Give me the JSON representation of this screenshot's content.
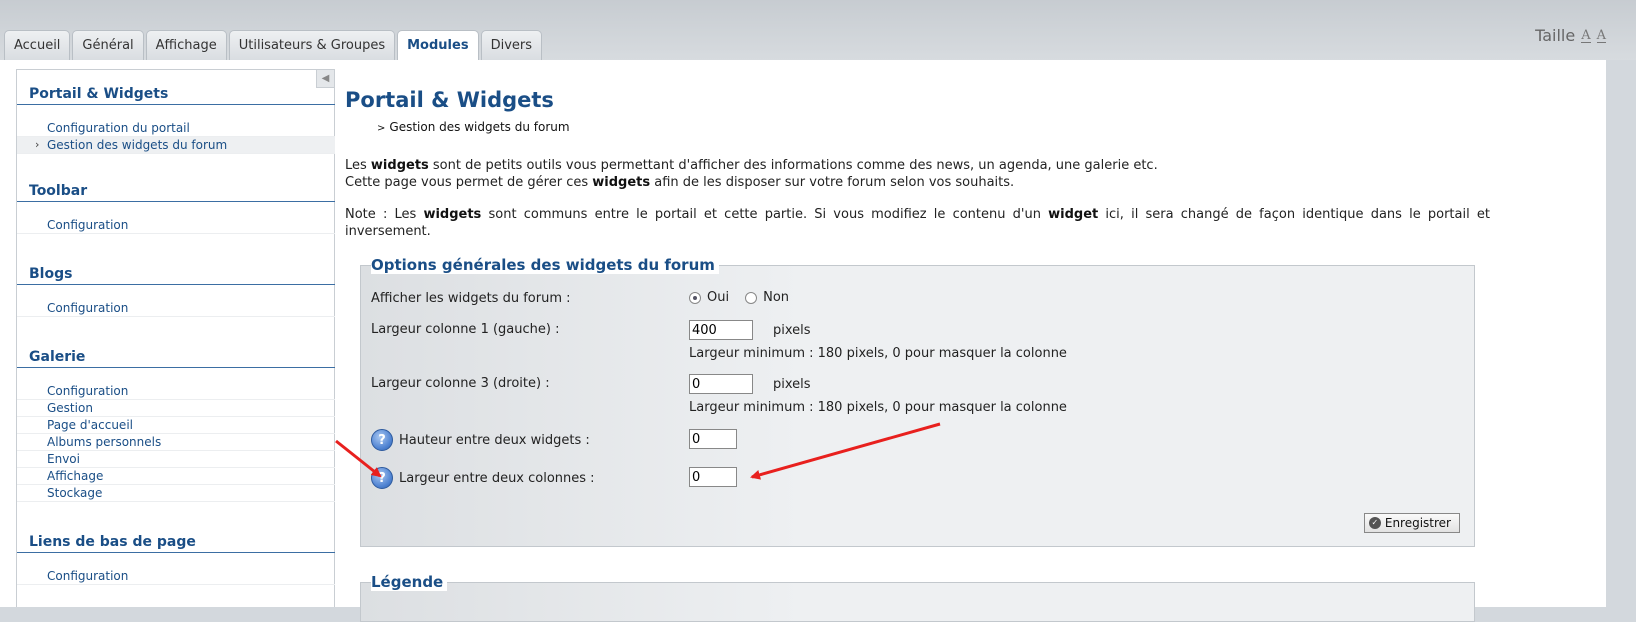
{
  "tabs": [
    {
      "label": "Accueil"
    },
    {
      "label": "Général"
    },
    {
      "label": "Affichage"
    },
    {
      "label": "Utilisateurs & Groupes"
    },
    {
      "label": "Modules",
      "active": true
    },
    {
      "label": "Divers"
    }
  ],
  "taille": {
    "label": "Taille"
  },
  "sidebar": {
    "sections": [
      {
        "title": "Portail & Widgets",
        "items": [
          "Configuration du portail",
          "Gestion des widgets du forum"
        ]
      },
      {
        "title": "Toolbar",
        "items": [
          "Configuration"
        ]
      },
      {
        "title": "Blogs",
        "items": [
          "Configuration"
        ]
      },
      {
        "title": "Galerie",
        "items": [
          "Configuration",
          "Gestion",
          "Page d'accueil",
          "Albums personnels",
          "Envoi",
          "Affichage",
          "Stockage"
        ]
      },
      {
        "title": "Liens de bas de page",
        "items": [
          "Configuration"
        ]
      }
    ],
    "active_item": "Gestion des widgets du forum"
  },
  "content": {
    "title": "Portail & Widgets",
    "breadcrumb": "Gestion des widgets du forum",
    "intro1_a": "Les ",
    "intro1_b": "widgets",
    "intro1_c": " sont de petits outils vous permettant d'afficher des informations comme des news, un agenda, une galerie etc.",
    "intro2_a": "Cette page vous permet de gérer ces ",
    "intro2_b": "widgets",
    "intro2_c": " afin de les disposer sur votre forum selon vos souhaits.",
    "note_a": "Note : Les ",
    "note_b": "widgets",
    "note_c": " sont communs entre le portail et cette partie. Si vous modifiez le contenu d'un ",
    "note_d": "widget",
    "note_e": " ici, il sera changé de façon identique dans le portail et inversement."
  },
  "options": {
    "legend": "Options générales des widgets du forum",
    "show_label": "Afficher les widgets du forum :",
    "yes": "Oui",
    "no": "Non",
    "selected": "Oui",
    "col1_label": "Largeur colonne 1 (gauche) :",
    "col1_value": "400",
    "col3_label": "Largeur colonne 3 (droite) :",
    "col3_value": "0",
    "unit": "pixels",
    "hint": "Largeur minimum : 180 pixels, 0 pour masquer la colonne",
    "height_label": "Hauteur entre deux widgets :",
    "height_value": "0",
    "width_label": "Largeur entre deux colonnes :",
    "width_value": "0",
    "save": "Enregistrer",
    "help_icon": "?"
  },
  "legend2": {
    "title": "Légende"
  },
  "annotation_color": "#e8201e"
}
